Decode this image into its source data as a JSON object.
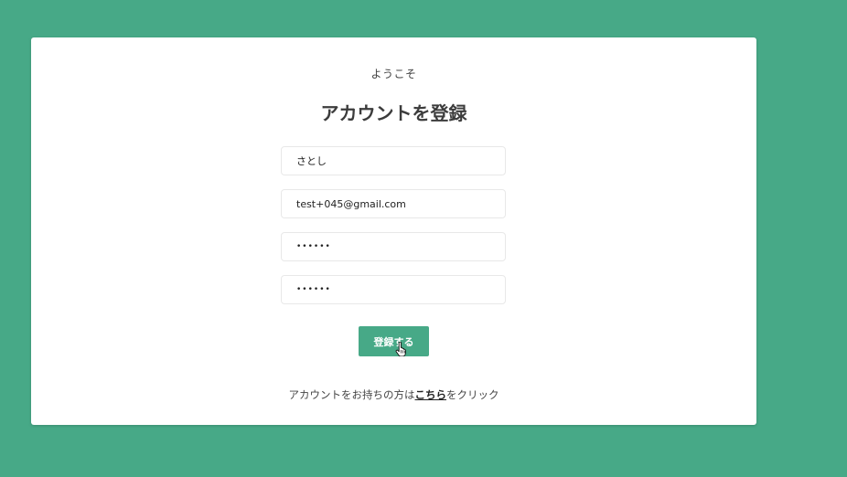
{
  "card": {
    "welcome": "ようこそ",
    "title": "アカウントを登録"
  },
  "form": {
    "name_value": "さとし",
    "email_value": "test+045@gmail.com",
    "password_value": "••••••",
    "password_confirm_value": "••••••",
    "submit_label": "登録する"
  },
  "login_prompt": {
    "prefix": "アカウントをお持ちの方は",
    "link_text": "こちら",
    "suffix": "をクリック"
  },
  "colors": {
    "background": "#47a987",
    "button": "#47a987",
    "card": "#ffffff"
  },
  "icons": {
    "cursor": "hand-pointer-icon"
  }
}
